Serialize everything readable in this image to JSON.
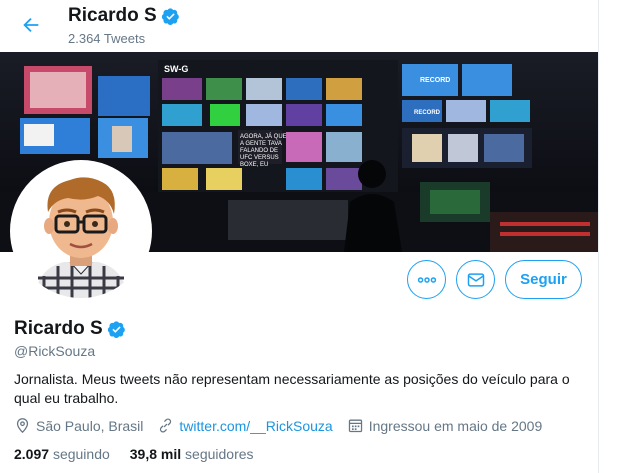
{
  "header": {
    "name": "Ricardo S",
    "tweet_count": "2.364 Tweets"
  },
  "banner": {
    "monitor_labels": [
      "SW-G",
      "RECORD",
      "RECORD",
      "AGORA, JÁ QUE A GENTE TAVA FALANDO DE UFC VERSUS BOXE, EU"
    ]
  },
  "profile": {
    "name": "Ricardo S",
    "handle": "@RickSouza",
    "bio": "Jornalista. Meus tweets não representam necessariamente as posições do veículo para o qual eu trabalho.",
    "location": "São Paulo, Brasil",
    "website": "twitter.com/__RickSouza",
    "joined": "Ingressou em maio de 2009"
  },
  "actions": {
    "follow_label": "Seguir"
  },
  "stats": {
    "following_count": "2.097",
    "following_label": "seguindo",
    "followers_count": "39,8 mil",
    "followers_label": "seguidores"
  },
  "colors": {
    "accent": "#1da1f2",
    "link": "#1b95e0",
    "muted": "#657786"
  },
  "icons": [
    "back-arrow-icon",
    "verified-badge-icon",
    "more-icon",
    "message-icon",
    "location-icon",
    "link-icon",
    "calendar-icon"
  ]
}
